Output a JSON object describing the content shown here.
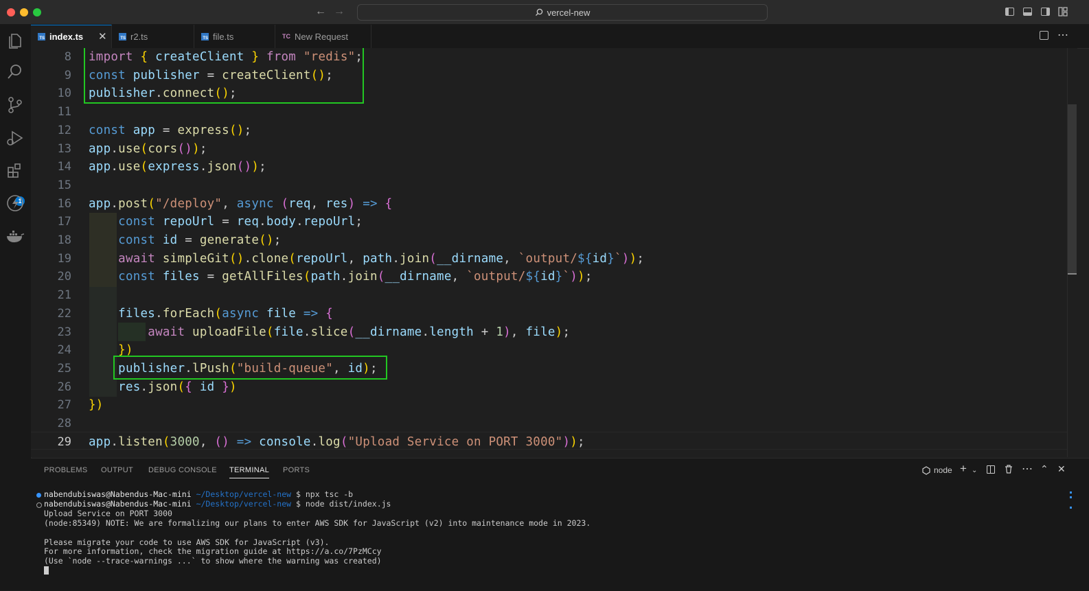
{
  "titlebar": {
    "search_text": "vercel-new",
    "search_icon": "search-icon",
    "back_icon": "arrow-left-icon",
    "forward_icon": "arrow-right-icon"
  },
  "activitybar": {
    "items": [
      {
        "name": "explorer",
        "icon": "files-icon"
      },
      {
        "name": "search",
        "icon": "search-icon"
      },
      {
        "name": "source-control",
        "icon": "source-control-icon"
      },
      {
        "name": "run-debug",
        "icon": "run-debug-icon"
      },
      {
        "name": "extensions",
        "icon": "extensions-icon",
        "badge": "1"
      },
      {
        "name": "thunder-client",
        "icon": "lightning-icon"
      },
      {
        "name": "docker",
        "icon": "docker-icon"
      }
    ]
  },
  "tabs": [
    {
      "label": "index.ts",
      "type": "TS",
      "active": true
    },
    {
      "label": "r2.ts",
      "type": "TS",
      "active": false
    },
    {
      "label": "file.ts",
      "type": "TS",
      "active": false
    },
    {
      "label": "New Request",
      "type": "TC",
      "active": false
    }
  ],
  "editor": {
    "current_line": "29",
    "lines": [
      {
        "num": "8",
        "text": "import { createClient } from \"redis\";"
      },
      {
        "num": "9",
        "text": "const publisher = createClient();"
      },
      {
        "num": "10",
        "text": "publisher.connect();"
      },
      {
        "num": "11",
        "text": ""
      },
      {
        "num": "12",
        "text": "const app = express();"
      },
      {
        "num": "13",
        "text": "app.use(cors());"
      },
      {
        "num": "14",
        "text": "app.use(express.json());"
      },
      {
        "num": "15",
        "text": ""
      },
      {
        "num": "16",
        "text": "app.post(\"/deploy\", async (req, res) => {"
      },
      {
        "num": "17",
        "text": "    const repoUrl = req.body.repoUrl;"
      },
      {
        "num": "18",
        "text": "    const id = generate();"
      },
      {
        "num": "19",
        "text": "    await simpleGit().clone(repoUrl, path.join(__dirname, `output/${id}`));"
      },
      {
        "num": "20",
        "text": "    const files = getAllFiles(path.join(__dirname, `output/${id}`));"
      },
      {
        "num": "21",
        "text": ""
      },
      {
        "num": "22",
        "text": "    files.forEach(async file => {"
      },
      {
        "num": "23",
        "text": "        await uploadFile(file.slice(__dirname.length + 1), file);"
      },
      {
        "num": "24",
        "text": "    })"
      },
      {
        "num": "25",
        "text": "    publisher.lPush(\"build-queue\", id);"
      },
      {
        "num": "26",
        "text": "    res.json({ id })"
      },
      {
        "num": "27",
        "text": "})"
      },
      {
        "num": "28",
        "text": ""
      },
      {
        "num": "29",
        "text": "app.listen(3000, () => console.log(\"Upload Service on PORT 3000\"));"
      }
    ]
  },
  "panel": {
    "tabs": [
      "PROBLEMS",
      "OUTPUT",
      "DEBUG CONSOLE",
      "TERMINAL",
      "PORTS"
    ],
    "active_tab": "TERMINAL",
    "shell": "node",
    "terminal": {
      "prompt_user": "nabendubiswas@Nabendus-Mac-mini",
      "prompt_path": "~/Desktop/vercel-new",
      "cmd1": "$ npx tsc -b",
      "cmd2": "$ node dist/index.js",
      "out1": "Upload Service on PORT 3000",
      "out2": "(node:85349) NOTE: We are formalizing our plans to enter AWS SDK for JavaScript (v2) into maintenance mode in 2023.",
      "out3": "",
      "out4": "Please migrate your code to use AWS SDK for JavaScript (v3).",
      "out5": "For more information, check the migration guide at https://a.co/7PzMCcy",
      "out6": "(Use `node --trace-warnings ...` to show where the warning was created)"
    }
  }
}
